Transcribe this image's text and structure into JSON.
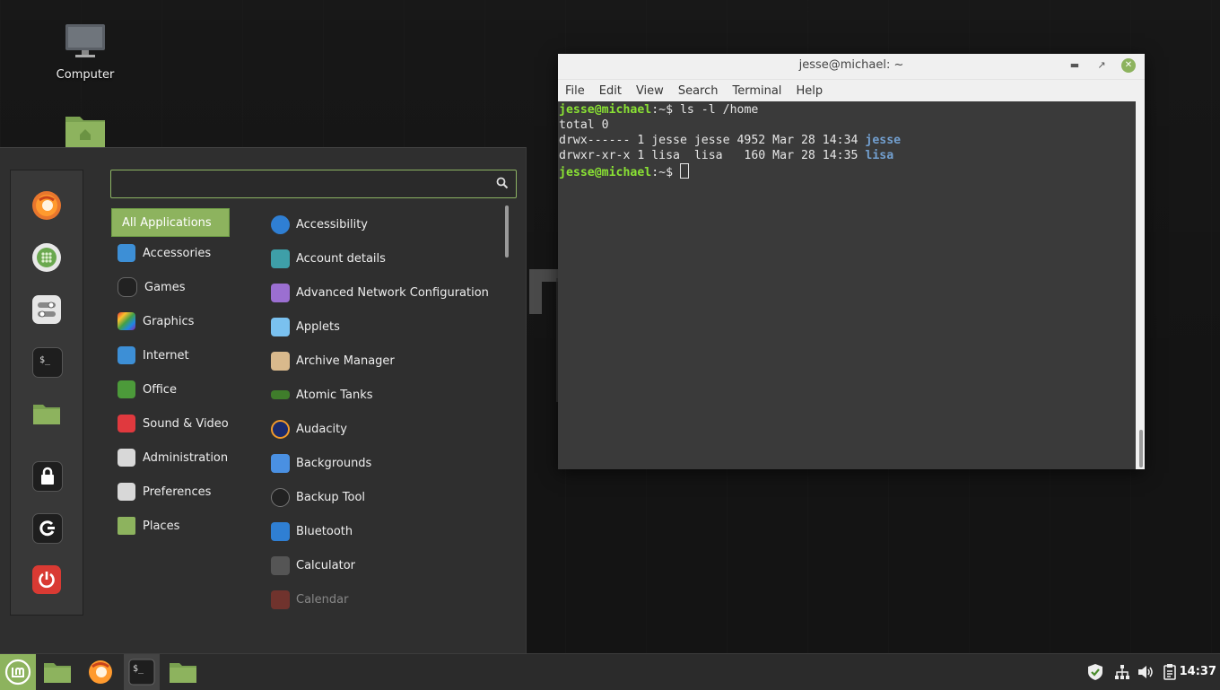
{
  "desktop": {
    "icons": [
      {
        "label": "Computer",
        "icon": "computer-icon"
      },
      {
        "label": "",
        "icon": "home-folder-icon"
      }
    ]
  },
  "terminal": {
    "title": "jesse@michael: ~",
    "menu": [
      "File",
      "Edit",
      "View",
      "Search",
      "Terminal",
      "Help"
    ],
    "prompt_user": "jesse@michael",
    "prompt_path": ":~$",
    "command": " ls -l /home",
    "line_total": "total 0",
    "line_jesse_prefix": "drwx------ 1 jesse jesse 4952 Mar 28 14:34 ",
    "line_jesse_name": "jesse",
    "line_lisa_prefix": "drwxr-xr-x 1 lisa  lisa   160 Mar 28 14:35 ",
    "line_lisa_name": "lisa",
    "colors": {
      "prompt": "#8ae234",
      "dir": "#729fcf",
      "background": "#3a3a3a"
    }
  },
  "menu": {
    "search": {
      "value": "",
      "placeholder": ""
    },
    "favorites": [
      "firefox-icon",
      "software-manager-icon",
      "settings-icon",
      "terminal-icon",
      "files-icon",
      "lock-icon",
      "logout-icon",
      "power-icon"
    ],
    "categories": [
      {
        "label": "All Applications",
        "icon": "all-apps"
      },
      {
        "label": "Accessories",
        "icon": "accessories-icon"
      },
      {
        "label": "Games",
        "icon": "games-icon"
      },
      {
        "label": "Graphics",
        "icon": "graphics-icon"
      },
      {
        "label": "Internet",
        "icon": "internet-icon"
      },
      {
        "label": "Office",
        "icon": "office-icon"
      },
      {
        "label": "Sound & Video",
        "icon": "sound-video-icon"
      },
      {
        "label": "Administration",
        "icon": "administration-icon"
      },
      {
        "label": "Preferences",
        "icon": "preferences-icon"
      },
      {
        "label": "Places",
        "icon": "places-icon"
      }
    ],
    "apps": [
      {
        "label": "Accessibility",
        "icon": "accessibility-icon"
      },
      {
        "label": "Account details",
        "icon": "account-icon"
      },
      {
        "label": "Advanced Network Configuration",
        "icon": "network-config-icon"
      },
      {
        "label": "Applets",
        "icon": "applets-icon"
      },
      {
        "label": "Archive Manager",
        "icon": "archive-icon"
      },
      {
        "label": "Atomic Tanks",
        "icon": "tank-icon"
      },
      {
        "label": "Audacity",
        "icon": "audacity-icon"
      },
      {
        "label": "Backgrounds",
        "icon": "backgrounds-icon"
      },
      {
        "label": "Backup Tool",
        "icon": "backup-icon"
      },
      {
        "label": "Bluetooth",
        "icon": "bluetooth-icon"
      },
      {
        "label": "Calculator",
        "icon": "calculator-icon"
      },
      {
        "label": "Calendar",
        "icon": "calendar-icon"
      }
    ],
    "accent": "#8db35e"
  },
  "taskbar": {
    "clock": "14:37",
    "items": [
      "mint-menu-icon",
      "files-icon",
      "firefox-icon",
      "terminal-icon",
      "folder-icon"
    ],
    "tray": [
      "shield-icon",
      "network-icon",
      "volume-icon",
      "clipboard-icon"
    ]
  }
}
